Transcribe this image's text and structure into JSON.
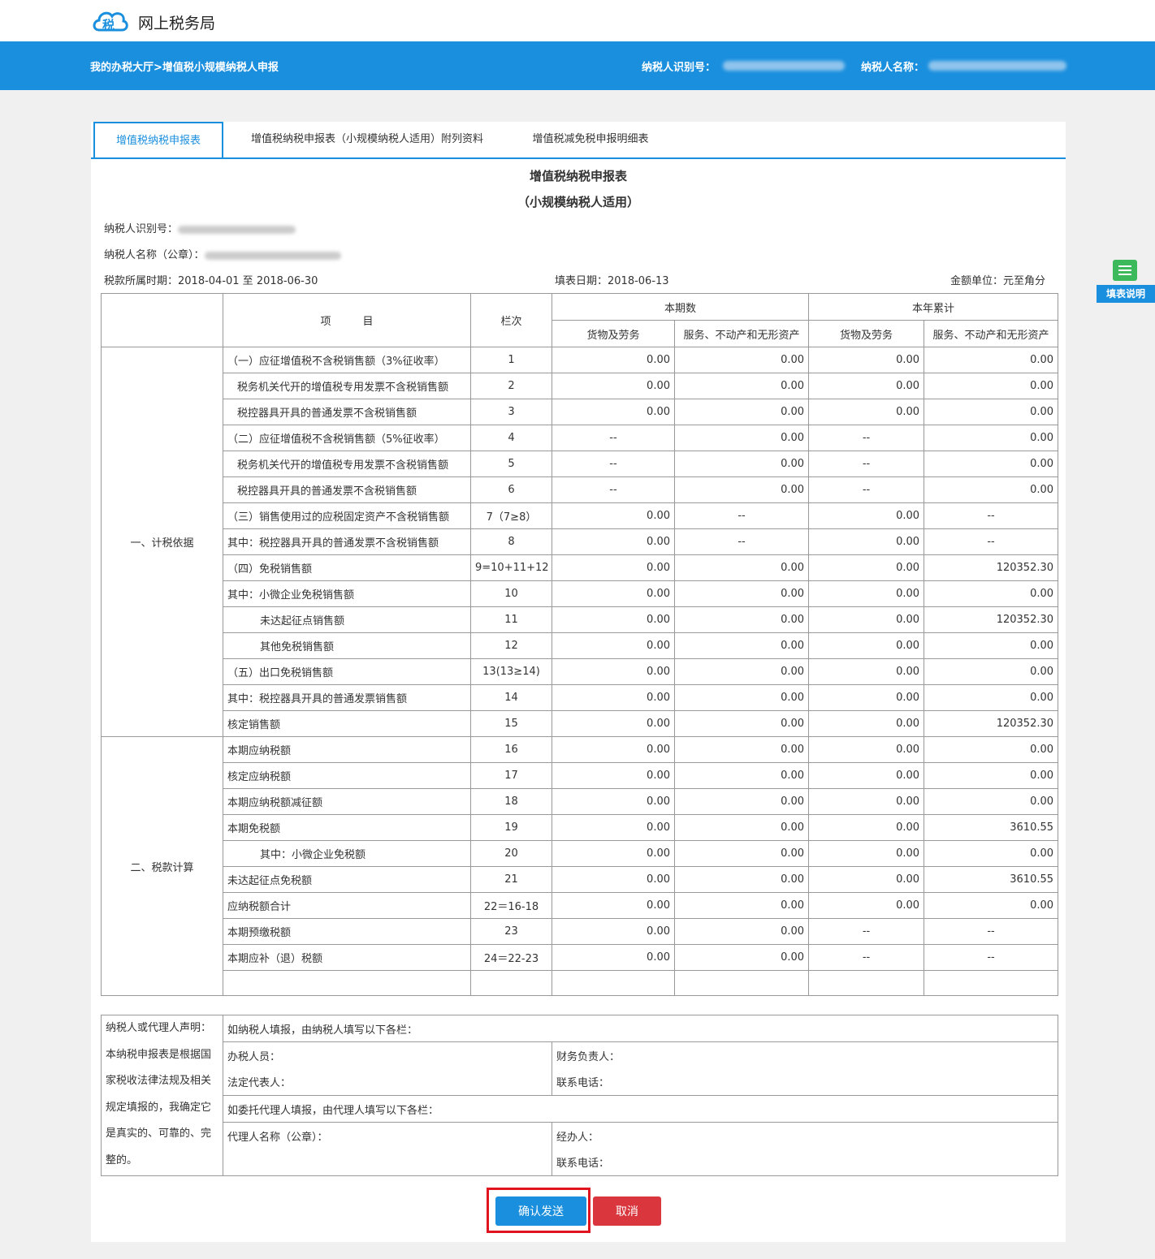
{
  "site": {
    "title": "网上税务局"
  },
  "header": {
    "breadcrumb": "我的办税大厅>增值税小规模纳税人申报",
    "taxpayer_id_label": "纳税人识别号：",
    "taxpayer_name_label": "纳税人名称："
  },
  "tabs": [
    {
      "label": "增值税纳税申报表",
      "active": true
    },
    {
      "label": "增值税纳税申报表（小规模纳税人适用）附列资料",
      "active": false
    },
    {
      "label": "增值税减免税申报明细表",
      "active": false
    }
  ],
  "form": {
    "title": "增值税纳税申报表",
    "subtitle": "（小规模纳税人适用）",
    "taxpayer_id_label": "纳税人识别号：",
    "taxpayer_name_label": "纳税人名称（公章）：",
    "period": "税款所属时期：2018-04-01 至 2018-06-30",
    "fill_date": "填表日期：2018-06-13",
    "unit": "金额单位：元至角分"
  },
  "table": {
    "headers": {
      "item": "项　　　目",
      "line": "栏次",
      "current": "本期数",
      "ytd": "本年累计",
      "goods": "货物及劳务",
      "services": "服务、不动产和无形资产"
    },
    "sections": {
      "basis": "一、计税依据",
      "calc": "二、税款计算"
    },
    "rows": [
      {
        "item": "（一）应征增值税不含税销售额（3%征收率）",
        "line": "1",
        "c1": "0.00",
        "c2": "0.00",
        "y1": "0.00",
        "y2": "0.00"
      },
      {
        "item": "税务机关代开的增值税专用发票不含税销售额",
        "line": "2",
        "c1": "0.00",
        "c2": "0.00",
        "y1": "0.00",
        "y2": "0.00"
      },
      {
        "item": "税控器具开具的普通发票不含税销售额",
        "line": "3",
        "c1": "0.00",
        "c2": "0.00",
        "y1": "0.00",
        "y2": "0.00"
      },
      {
        "item": "（二）应征增值税不含税销售额（5%征收率）",
        "line": "4",
        "c1": "--",
        "c2": "0.00",
        "y1": "--",
        "y2": "0.00"
      },
      {
        "item": "税务机关代开的增值税专用发票不含税销售额",
        "line": "5",
        "c1": "--",
        "c2": "0.00",
        "y1": "--",
        "y2": "0.00"
      },
      {
        "item": "税控器具开具的普通发票不含税销售额",
        "line": "6",
        "c1": "--",
        "c2": "0.00",
        "y1": "--",
        "y2": "0.00"
      },
      {
        "item": "（三）销售使用过的应税固定资产不含税销售额",
        "line": "7（7≥8）",
        "c1": "0.00",
        "c2": "--",
        "y1": "0.00",
        "y2": "--"
      },
      {
        "item": "其中：税控器具开具的普通发票不含税销售额",
        "line": "8",
        "c1": "0.00",
        "c2": "--",
        "y1": "0.00",
        "y2": "--"
      },
      {
        "item": "（四）免税销售额",
        "line": "9=10+11+12",
        "c1": "0.00",
        "c2": "0.00",
        "y1": "0.00",
        "y2": "120352.30"
      },
      {
        "item": "其中：小微企业免税销售额",
        "line": "10",
        "c1": "0.00",
        "c2": "0.00",
        "y1": "0.00",
        "y2": "0.00"
      },
      {
        "item": "未达起征点销售额",
        "line": "11",
        "c1": "0.00",
        "c2": "0.00",
        "y1": "0.00",
        "y2": "120352.30"
      },
      {
        "item": "其他免税销售额",
        "line": "12",
        "c1": "0.00",
        "c2": "0.00",
        "y1": "0.00",
        "y2": "0.00"
      },
      {
        "item": "（五）出口免税销售额",
        "line": "13(13≥14)",
        "c1": "0.00",
        "c2": "0.00",
        "y1": "0.00",
        "y2": "0.00"
      },
      {
        "item": "其中：税控器具开具的普通发票销售额",
        "line": "14",
        "c1": "0.00",
        "c2": "0.00",
        "y1": "0.00",
        "y2": "0.00"
      },
      {
        "item": "核定销售额",
        "line": "15",
        "c1": "0.00",
        "c2": "0.00",
        "y1": "0.00",
        "y2": "120352.30"
      },
      {
        "item": "本期应纳税额",
        "line": "16",
        "c1": "0.00",
        "c2": "0.00",
        "y1": "0.00",
        "y2": "0.00"
      },
      {
        "item": "核定应纳税额",
        "line": "17",
        "c1": "0.00",
        "c2": "0.00",
        "y1": "0.00",
        "y2": "0.00"
      },
      {
        "item": "本期应纳税额减征额",
        "line": "18",
        "c1": "0.00",
        "c2": "0.00",
        "y1": "0.00",
        "y2": "0.00"
      },
      {
        "item": "本期免税额",
        "line": "19",
        "c1": "0.00",
        "c2": "0.00",
        "y1": "0.00",
        "y2": "3610.55"
      },
      {
        "item": "其中：小微企业免税额",
        "line": "20",
        "c1": "0.00",
        "c2": "0.00",
        "y1": "0.00",
        "y2": "0.00"
      },
      {
        "item": "未达起征点免税额",
        "line": "21",
        "c1": "0.00",
        "c2": "0.00",
        "y1": "0.00",
        "y2": "3610.55"
      },
      {
        "item": "应纳税额合计",
        "line": "22＝16-18",
        "c1": "0.00",
        "c2": "0.00",
        "y1": "0.00",
        "y2": "0.00"
      },
      {
        "item": "本期预缴税额",
        "line": "23",
        "c1": "0.00",
        "c2": "0.00",
        "y1": "--",
        "y2": "--"
      },
      {
        "item": "本期应补（退）税额",
        "line": "24＝22-23",
        "c1": "0.00",
        "c2": "0.00",
        "y1": "--",
        "y2": "--"
      }
    ]
  },
  "declaration": {
    "statement": "纳税人或代理人声明：本纳税申报表是根据国家税收法律法规及相关规定填报的，我确定它是真实的、可靠的、完整的。",
    "self_note": "如纳税人填报，由纳税人填写以下各栏：",
    "handler": "办税人员：",
    "finance_head": "财务负责人：",
    "legal_rep": "法定代表人：",
    "phone": "联系电话：",
    "agent_note": "如委托代理人填报，由代理人填写以下各栏：",
    "agent_name": "代理人名称（公章）：",
    "operator": "经办人：",
    "agent_phone": "联系电话："
  },
  "buttons": {
    "confirm": "确认发送",
    "cancel": "取消"
  },
  "help": {
    "label": "填表说明"
  },
  "colors": {
    "primary": "#1a8fde",
    "danger": "#d9363e",
    "highlight": "#e0141e",
    "help_icon": "#3cb95a"
  }
}
